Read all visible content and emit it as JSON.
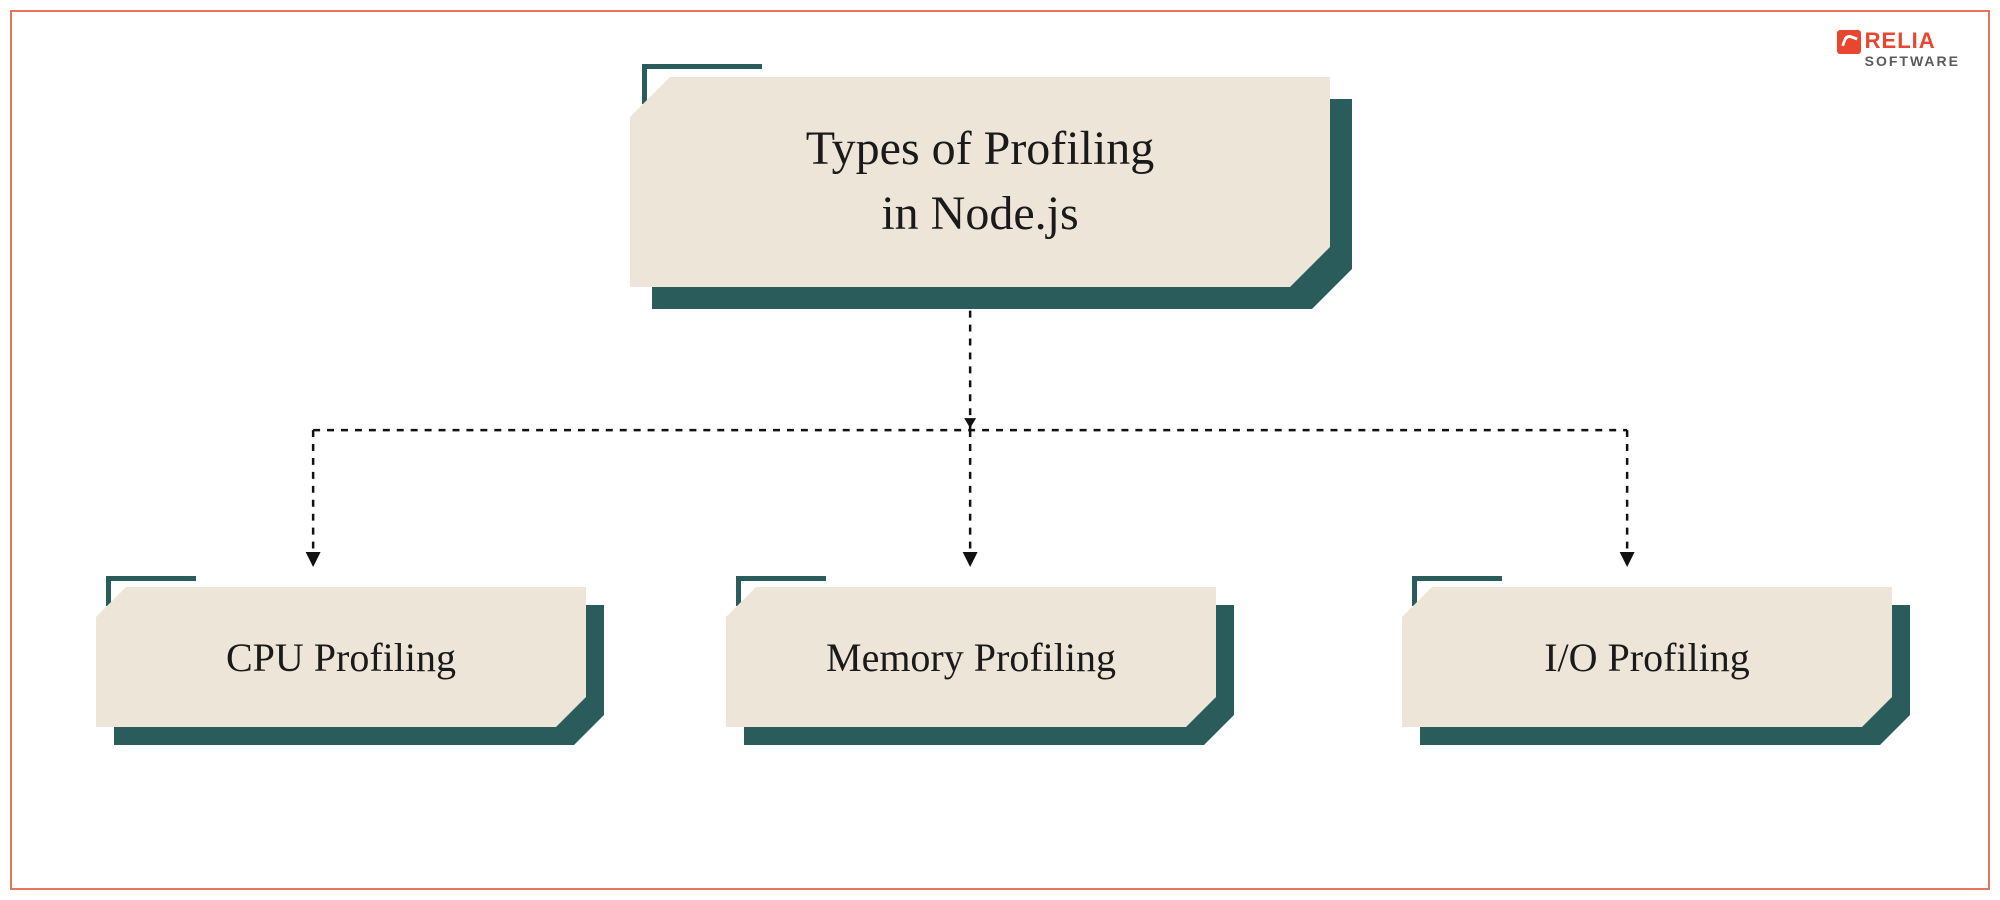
{
  "logo": {
    "line1": "RELIA",
    "line2": "SOFTWARE"
  },
  "diagram": {
    "title": "Types of Profiling\nin Node.js",
    "children": [
      {
        "label": "CPU Profiling"
      },
      {
        "label": "Memory Profiling"
      },
      {
        "label": "I/O Profiling"
      }
    ]
  },
  "colors": {
    "frame_border": "#e8745a",
    "box_fill": "#ece5d8",
    "box_shadow": "#2a5c5c",
    "logo_accent": "#e8462f"
  }
}
